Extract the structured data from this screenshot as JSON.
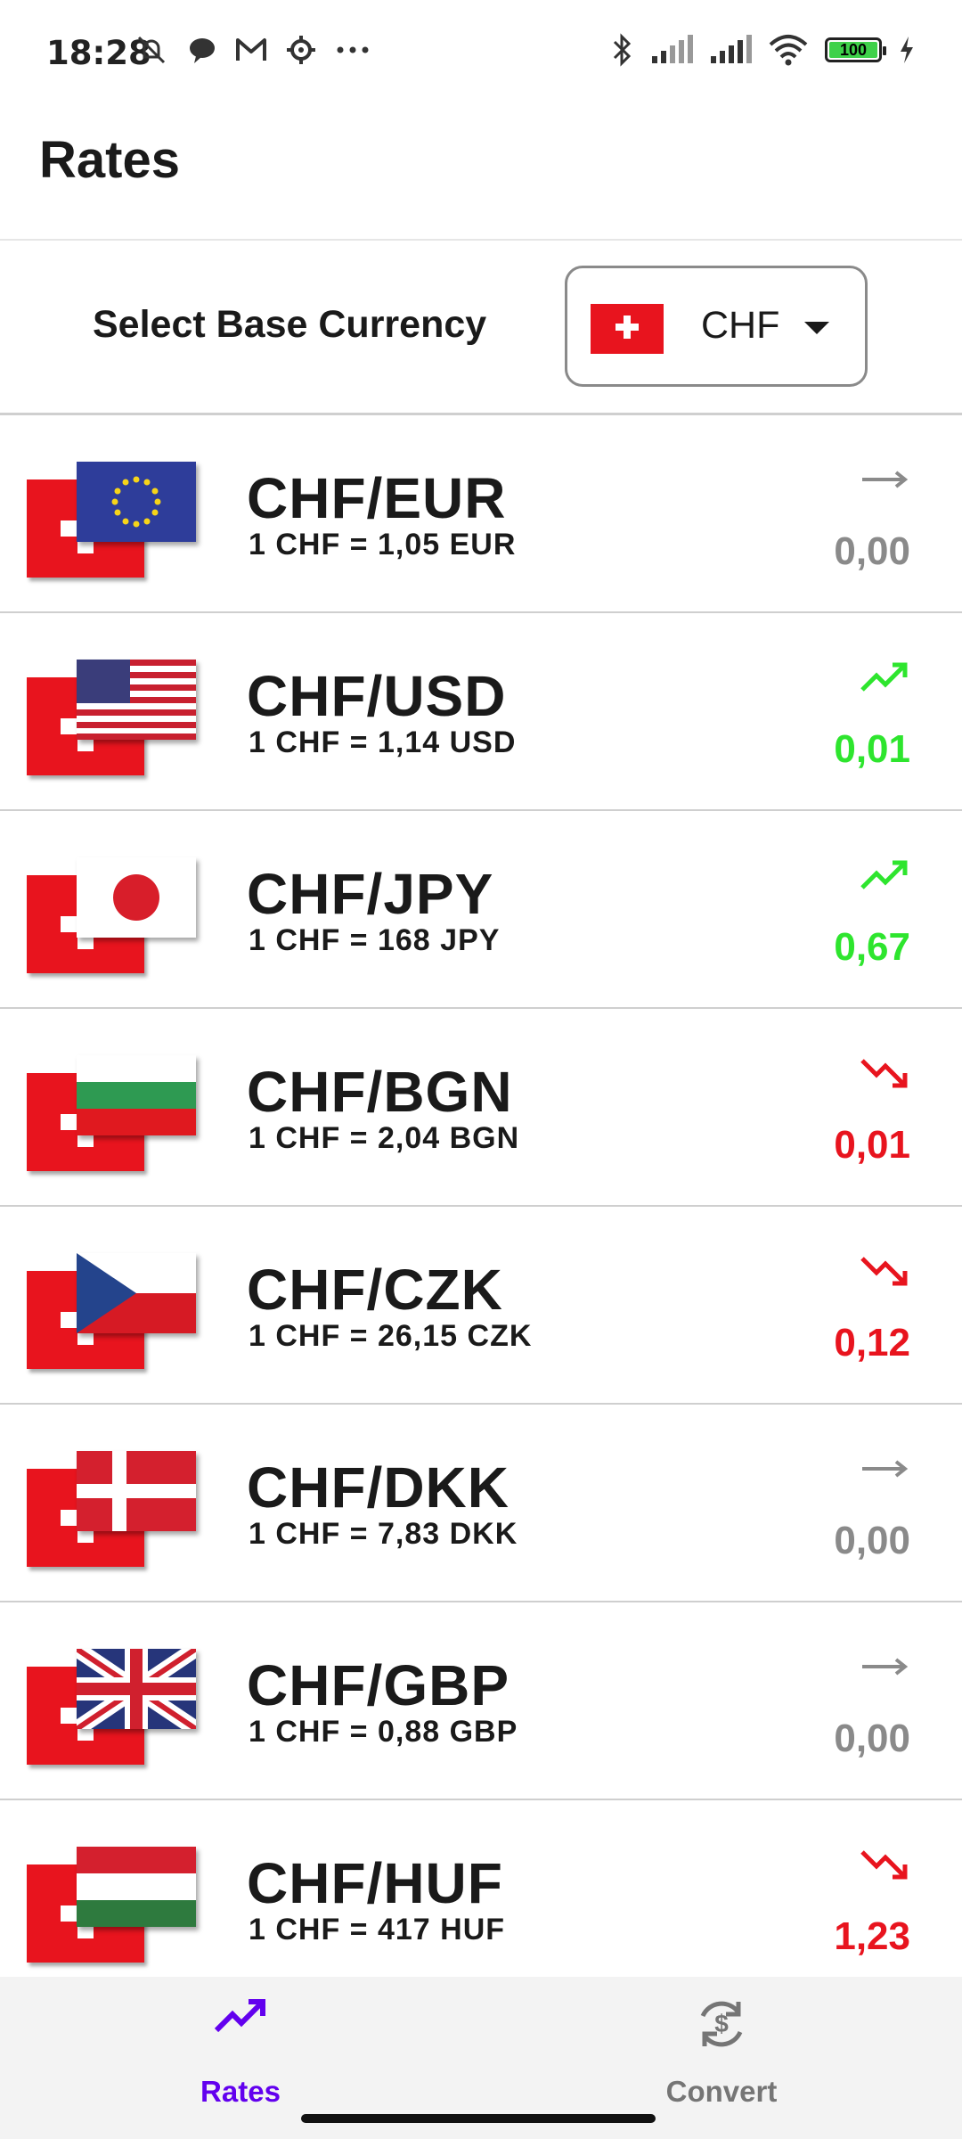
{
  "status": {
    "time": "18:28",
    "battery": "100",
    "left_icons": [
      "mute-notification-icon",
      "chat-bubble-icon",
      "gmail-icon",
      "settings-gear-icon",
      "more-dots-icon"
    ],
    "right_icons": [
      "bluetooth-icon",
      "signal-icon",
      "signal-icon",
      "wifi-icon",
      "battery-icon",
      "charging-icon"
    ]
  },
  "header": {
    "title": "Rates"
  },
  "base": {
    "label": "Select Base Currency",
    "selected": "CHF"
  },
  "rows": [
    {
      "pair": "CHF/EUR",
      "rate": "1 CHF = 1,05 EUR",
      "delta": "0,00",
      "trend": "flat",
      "flag": "eu"
    },
    {
      "pair": "CHF/USD",
      "rate": "1 CHF = 1,14 USD",
      "delta": "0,01",
      "trend": "up",
      "flag": "us"
    },
    {
      "pair": "CHF/JPY",
      "rate": "1 CHF = 168 JPY",
      "delta": "0,67",
      "trend": "up",
      "flag": "jp"
    },
    {
      "pair": "CHF/BGN",
      "rate": "1 CHF = 2,04 BGN",
      "delta": "0,01",
      "trend": "down",
      "flag": "bg"
    },
    {
      "pair": "CHF/CZK",
      "rate": "1 CHF = 26,15 CZK",
      "delta": "0,12",
      "trend": "down",
      "flag": "cz"
    },
    {
      "pair": "CHF/DKK",
      "rate": "1 CHF = 7,83 DKK",
      "delta": "0,00",
      "trend": "flat",
      "flag": "dk"
    },
    {
      "pair": "CHF/GBP",
      "rate": "1 CHF = 0,88 GBP",
      "delta": "0,00",
      "trend": "flat",
      "flag": "gb"
    },
    {
      "pair": "CHF/HUF",
      "rate": "1 CHF = 417 HUF",
      "delta": "1,23",
      "trend": "down",
      "flag": "hu"
    }
  ],
  "nav": {
    "rates": {
      "label": "Rates",
      "icon": "trending-up-icon"
    },
    "convert": {
      "label": "Convert",
      "icon": "currency-exchange-icon"
    }
  },
  "colors": {
    "accent": "#6200ee",
    "up": "#2ee52e",
    "down": "#e8141e",
    "flat": "#8a8a8a",
    "nav_inactive": "#757575"
  }
}
